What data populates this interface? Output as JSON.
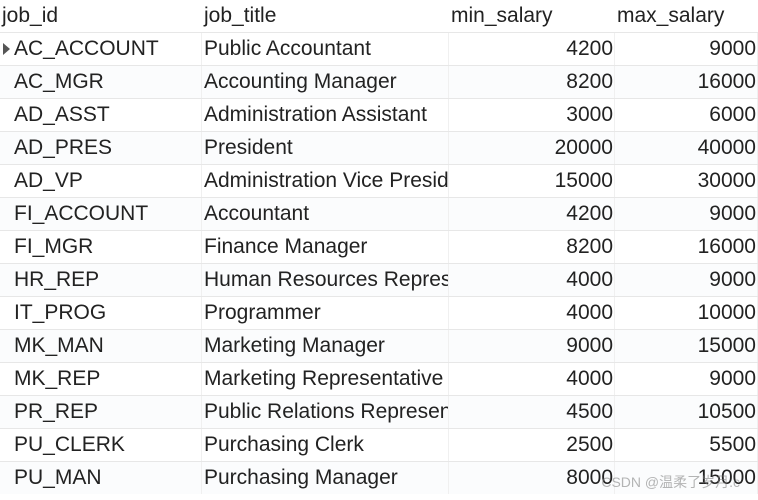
{
  "columns": {
    "job_id": "job_id",
    "job_title": "job_title",
    "min_salary": "min_salary",
    "max_salary": "max_salary"
  },
  "rows": [
    {
      "job_id": "AC_ACCOUNT",
      "job_title": "Public Accountant",
      "min_salary": "4200",
      "max_salary": "9000"
    },
    {
      "job_id": "AC_MGR",
      "job_title": "Accounting Manager",
      "min_salary": "8200",
      "max_salary": "16000"
    },
    {
      "job_id": "AD_ASST",
      "job_title": "Administration Assistant",
      "min_salary": "3000",
      "max_salary": "6000"
    },
    {
      "job_id": "AD_PRES",
      "job_title": "President",
      "min_salary": "20000",
      "max_salary": "40000"
    },
    {
      "job_id": "AD_VP",
      "job_title": "Administration Vice President",
      "min_salary": "15000",
      "max_salary": "30000"
    },
    {
      "job_id": "FI_ACCOUNT",
      "job_title": "Accountant",
      "min_salary": "4200",
      "max_salary": "9000"
    },
    {
      "job_id": "FI_MGR",
      "job_title": "Finance Manager",
      "min_salary": "8200",
      "max_salary": "16000"
    },
    {
      "job_id": "HR_REP",
      "job_title": "Human Resources Representative",
      "min_salary": "4000",
      "max_salary": "9000"
    },
    {
      "job_id": "IT_PROG",
      "job_title": "Programmer",
      "min_salary": "4000",
      "max_salary": "10000"
    },
    {
      "job_id": "MK_MAN",
      "job_title": "Marketing Manager",
      "min_salary": "9000",
      "max_salary": "15000"
    },
    {
      "job_id": "MK_REP",
      "job_title": "Marketing Representative",
      "min_salary": "4000",
      "max_salary": "9000"
    },
    {
      "job_id": "PR_REP",
      "job_title": "Public Relations Representative",
      "min_salary": "4500",
      "max_salary": "10500"
    },
    {
      "job_id": "PU_CLERK",
      "job_title": "Purchasing Clerk",
      "min_salary": "2500",
      "max_salary": "5500"
    },
    {
      "job_id": "PU_MAN",
      "job_title": "Purchasing Manager",
      "min_salary": "8000",
      "max_salary": "15000"
    }
  ],
  "current_row_index": 0,
  "watermark": "CSDN @温柔了岁月.c"
}
